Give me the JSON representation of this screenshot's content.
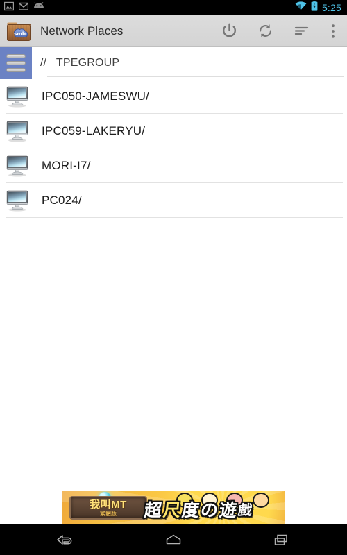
{
  "status_bar": {
    "icons_left": [
      "photo-icon",
      "gmail-icon",
      "android-face-icon"
    ],
    "icons_right": [
      "wifi-icon",
      "battery-charging-icon"
    ],
    "clock": "5:25",
    "accent_color": "#4fc3e8",
    "background": "#000000"
  },
  "action_bar": {
    "app_icon": "smb-folder-icon",
    "app_icon_label": "smb",
    "title": "Network Places",
    "background": "#d8d8d8",
    "actions": [
      {
        "name": "power-icon",
        "glyph": "power"
      },
      {
        "name": "refresh-icon",
        "glyph": "refresh"
      },
      {
        "name": "sort-icon",
        "glyph": "sort"
      },
      {
        "name": "overflow-menu-icon",
        "glyph": "dots"
      }
    ]
  },
  "breadcrumb": {
    "menu_button_color": "#6b82c4",
    "menu_icon": "hamburger-list-icon",
    "separator": "//",
    "path": "TPEGROUP"
  },
  "list": {
    "item_icon": "computer-monitor-icon",
    "items": [
      {
        "label": "IPC050-JAMESWU/"
      },
      {
        "label": "IPC059-LAKERYU/"
      },
      {
        "label": "MORI-I7/"
      },
      {
        "label": "PC024/"
      }
    ]
  },
  "ad_banner": {
    "brand_title": "我叫MT",
    "brand_subtitle": "繁體版",
    "headline_1": "超",
    "headline_2": "尺",
    "headline_3": "度",
    "headline_4": "の",
    "headline_5": "遊",
    "headline_6": "戲"
  },
  "nav_bar": {
    "buttons": [
      {
        "name": "back-button"
      },
      {
        "name": "home-button"
      },
      {
        "name": "recents-button"
      }
    ],
    "background": "#000000"
  }
}
